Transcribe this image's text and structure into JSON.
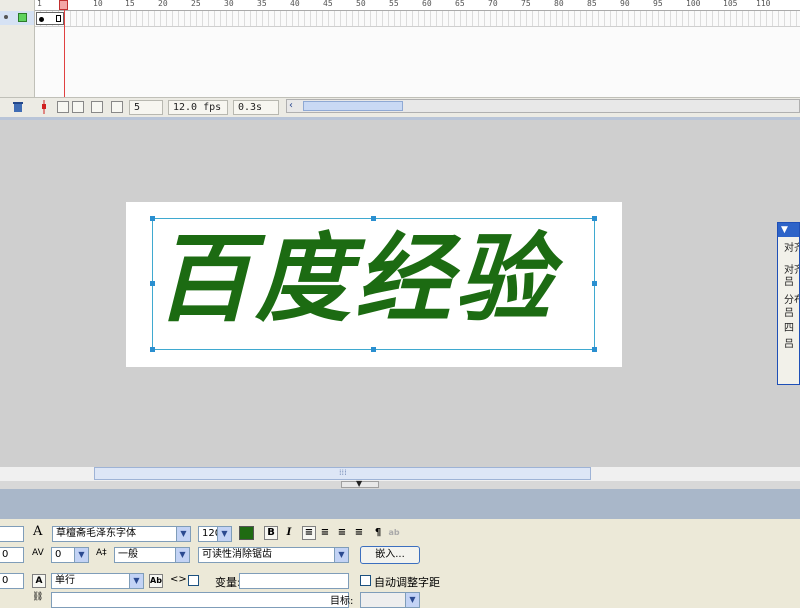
{
  "timeline": {
    "ruler_labels": [
      "1",
      "5",
      "10",
      "15",
      "20",
      "25",
      "30",
      "35",
      "40",
      "45",
      "50",
      "55",
      "60",
      "65",
      "70",
      "75",
      "80",
      "85",
      "90",
      "95",
      "100",
      "105",
      "110"
    ],
    "current_frame": "5",
    "frame_rate": "12.0 fps",
    "elapsed_time": "0.3s"
  },
  "stage": {
    "text_content": "百度经验",
    "text_color": "#1c6b12"
  },
  "align_panel": {
    "rows": [
      "对齐",
      "对齐",
      "吕",
      "分布",
      "吕",
      "四",
      "吕"
    ]
  },
  "properties": {
    "font_family": "草檀斋毛泽东字体",
    "font_size": "120",
    "fill_color": "#1f6b12",
    "bold_label": "B",
    "italic_label": "I",
    "letter_spacing": "0",
    "char_position": "一般",
    "anti_alias": "可读性消除锯齿",
    "embed_button": "嵌入...",
    "line_type": "单行",
    "var_label": "变量:",
    "var_value": "",
    "auto_kern_label": "自动调整字距",
    "target_label": "目标:",
    "left_value_1": "0",
    "left_value_2": "0"
  }
}
